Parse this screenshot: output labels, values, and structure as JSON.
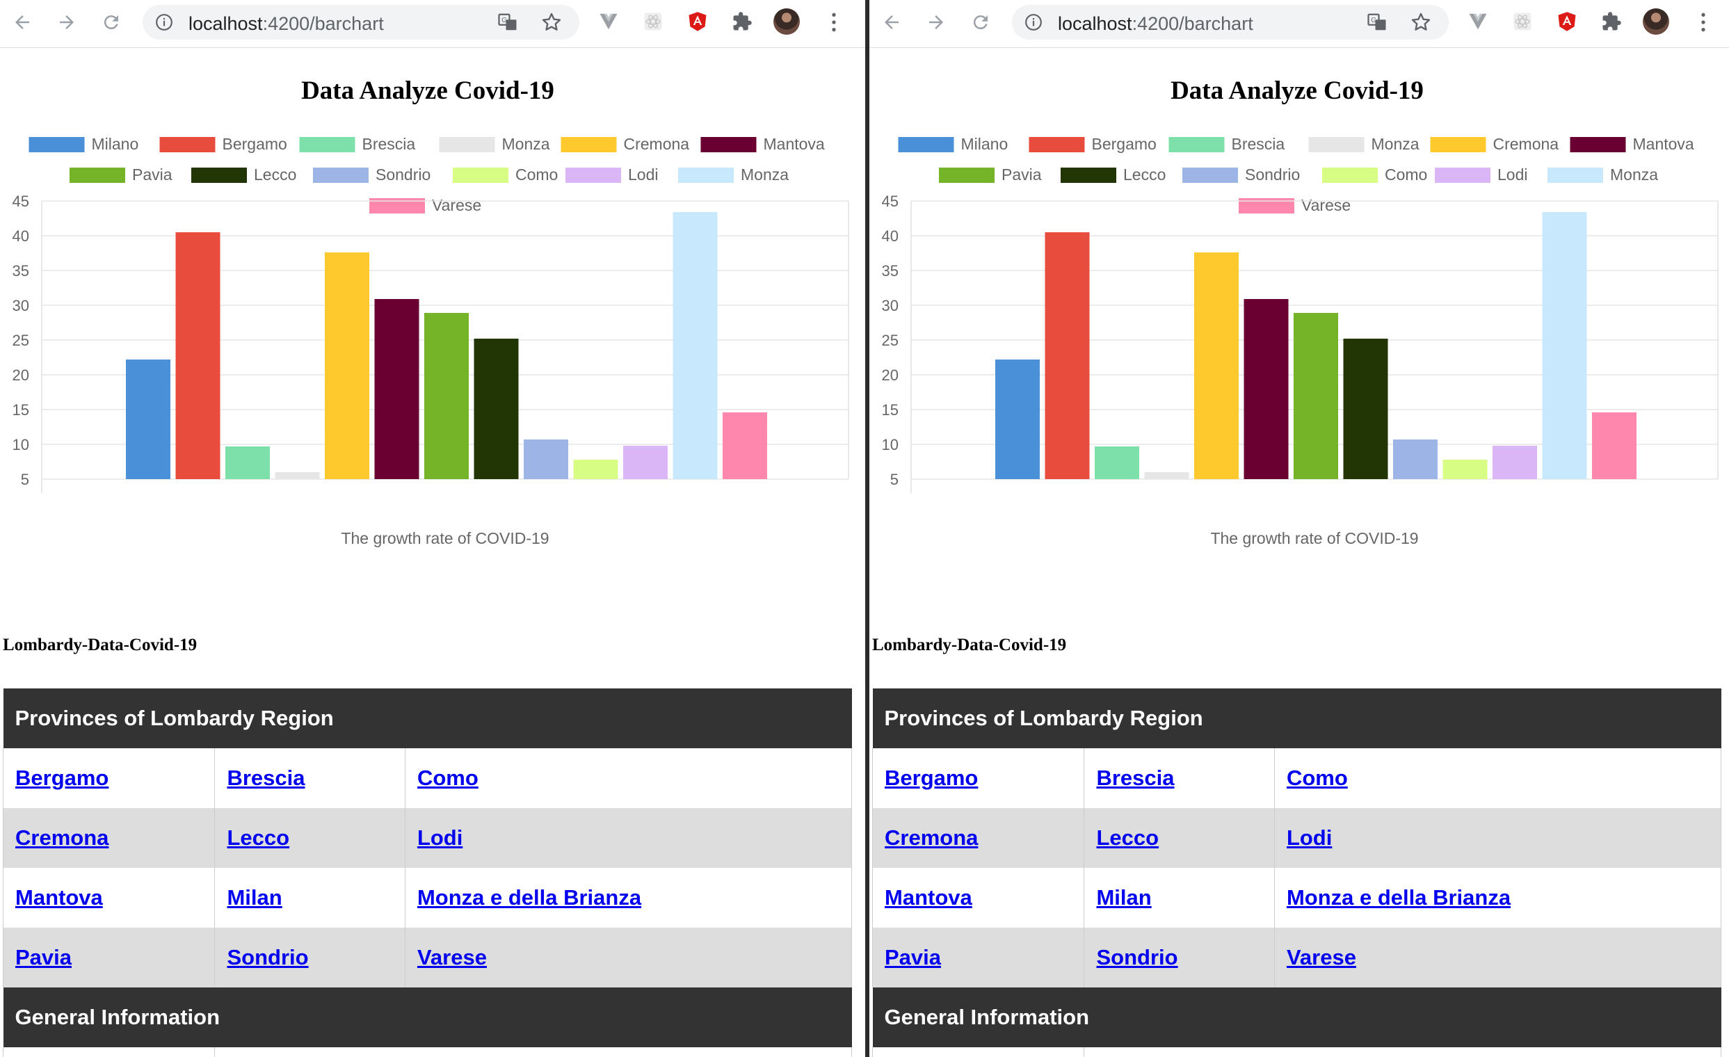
{
  "browser": {
    "url_host": "localhost",
    "url_path": ":4200/barchart"
  },
  "page": {
    "title": "Data Analyze Covid-19",
    "section_label": "Lombardy-Data-Covid-19"
  },
  "chart_data": {
    "type": "bar",
    "title": "",
    "xlabel": "The growth rate of COVID-19",
    "ylabel": "",
    "ylim": [
      5,
      45
    ],
    "yticks": [
      5,
      10,
      15,
      20,
      25,
      30,
      35,
      40,
      45
    ],
    "grid": true,
    "legend_position": "top",
    "series": [
      {
        "name": "Milano",
        "value": 22.2,
        "color": "#4a90d9"
      },
      {
        "name": "Bergamo",
        "value": 40.5,
        "color": "#e84c3d"
      },
      {
        "name": "Brescia",
        "value": 9.7,
        "color": "#7de0aa"
      },
      {
        "name": "Monza",
        "value": 6.0,
        "color": "#e6e6e6"
      },
      {
        "name": "Cremona",
        "value": 37.6,
        "color": "#fec92c"
      },
      {
        "name": "Mantova",
        "value": 30.9,
        "color": "#690031"
      },
      {
        "name": "Pavia",
        "value": 28.9,
        "color": "#75b428"
      },
      {
        "name": "Lecco",
        "value": 25.2,
        "color": "#223505"
      },
      {
        "name": "Sondrio",
        "value": 10.7,
        "color": "#9cb4e6"
      },
      {
        "name": "Como",
        "value": 7.8,
        "color": "#d8fd85"
      },
      {
        "name": "Lodi",
        "value": 9.8,
        "color": "#dbb6f7"
      },
      {
        "name": "Monza",
        "value": 43.4,
        "color": "#c8e9fd"
      },
      {
        "name": "Varese",
        "value": 14.6,
        "color": "#fe88ad"
      }
    ]
  },
  "table": {
    "provinces_header": "Provinces of Lombardy Region",
    "rows": [
      [
        "Bergamo",
        "Brescia",
        "Como"
      ],
      [
        "Cremona",
        "Lecco",
        "Lodi"
      ],
      [
        "Mantova",
        "Milan",
        "Monza e della Brianza"
      ],
      [
        "Pavia",
        "Sondrio",
        "Varese"
      ]
    ],
    "general_header": "General Information"
  }
}
